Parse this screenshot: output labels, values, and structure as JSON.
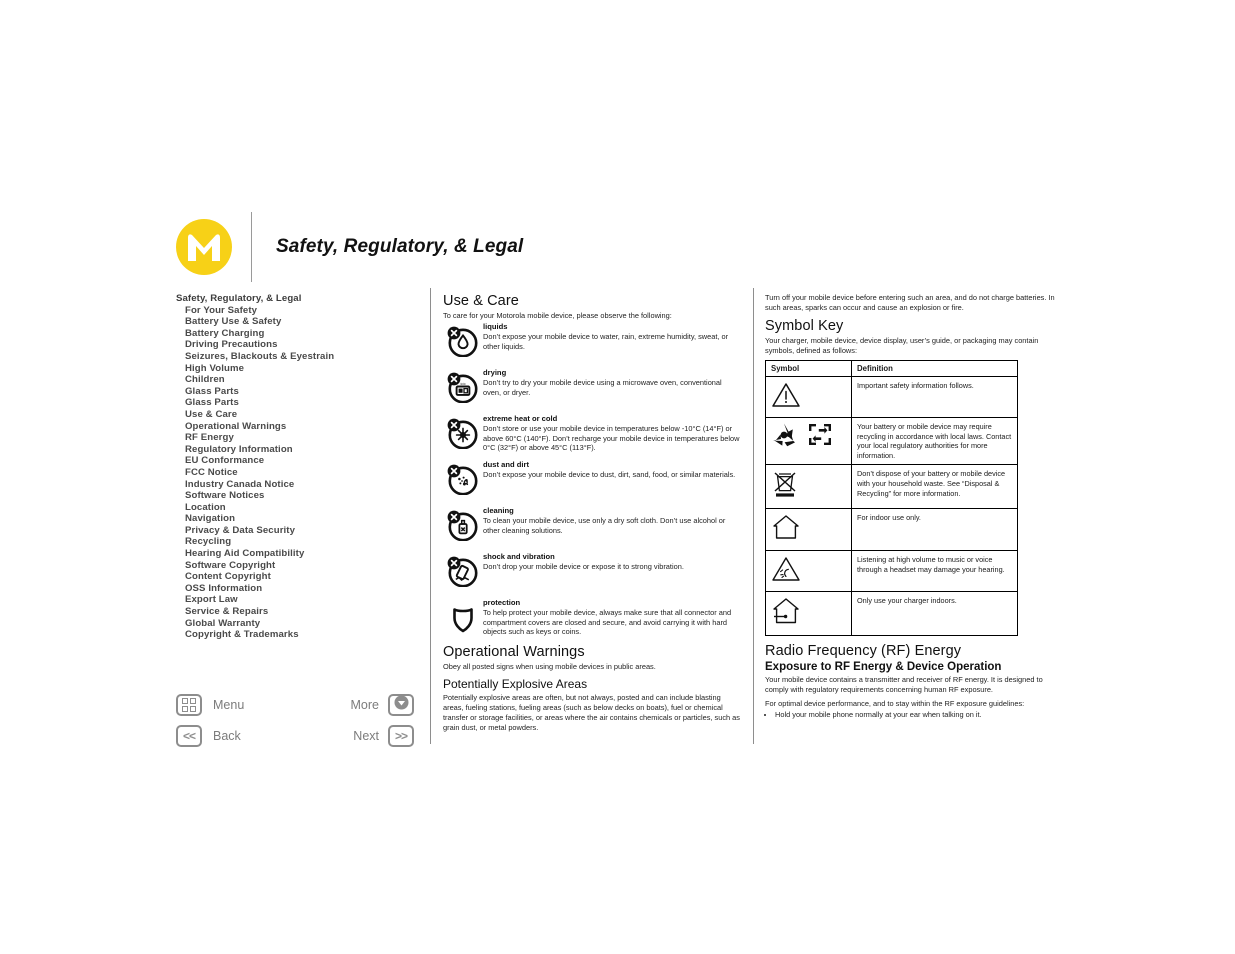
{
  "header": {
    "title": "Safety, Regulatory, & Legal",
    "logo_icon": "motorola-logo-icon"
  },
  "sidebar": {
    "title": "Safety, Regulatory, & Legal",
    "items": [
      "For Your Safety",
      "Battery Use & Safety",
      "Battery Charging",
      "Driving Precautions",
      "Seizures, Blackouts & Eyestrain",
      "High Volume",
      "Children",
      "Glass Parts",
      "Glass Parts",
      "Use & Care",
      "Operational Warnings",
      "RF Energy",
      "Regulatory Information",
      "EU Conformance",
      "FCC Notice",
      "Industry Canada Notice",
      "Software Notices",
      "Location",
      "Navigation",
      "Privacy & Data Security",
      "Recycling",
      "Hearing Aid Compatibility",
      "Software Copyright",
      "Content Copyright",
      "OSS Information",
      "Export Law",
      "Service & Repairs",
      "Global Warranty",
      "Copyright & Trademarks"
    ]
  },
  "nav_controls": {
    "menu_label": "Menu",
    "more_label": "More",
    "back_label": "Back",
    "next_label": "Next",
    "back_glyph": "<<",
    "next_glyph": ">>"
  },
  "use_care": {
    "heading": "Use & Care",
    "intro": "To care for your Motorola mobile device, please observe the following:",
    "items": [
      {
        "icon": "no-liquids-icon",
        "term": "liquids",
        "desc": "Don’t expose your mobile device to water, rain, extreme humidity, sweat, or other liquids."
      },
      {
        "icon": "no-drying-icon",
        "term": "drying",
        "desc": "Don’t try to dry your mobile device using a microwave oven, conventional oven, or dryer."
      },
      {
        "icon": "no-extreme-temperature-icon",
        "term": "extreme heat or cold",
        "desc": "Don’t store or use your mobile device in temperatures below -10°C (14°F) or above 60°C (140°F). Don’t recharge your mobile device in temperatures below 0°C (32°F) or above 45°C (113°F)."
      },
      {
        "icon": "no-dust-icon",
        "term": "dust and dirt",
        "desc": "Don’t expose your mobile device to dust, dirt, sand, food, or similar materials."
      },
      {
        "icon": "no-cleaning-solutions-icon",
        "term": "cleaning",
        "desc": "To clean your mobile device, use only a dry soft cloth. Don’t use alcohol or other cleaning solutions."
      },
      {
        "icon": "no-shock-vibration-icon",
        "term": "shock and vibration",
        "desc": "Don’t drop your mobile device or expose it to strong vibration."
      },
      {
        "icon": "shield-protection-icon",
        "term": "protection",
        "desc": "To help protect your mobile device, always make sure that all connector and compartment covers are closed and secure, and avoid carrying it with hard objects such as keys or coins."
      }
    ]
  },
  "operational_warnings": {
    "heading": "Operational Warnings",
    "intro": "Obey all posted signs when using mobile devices in public areas.",
    "subheading": "Potentially Explosive Areas",
    "body": "Potentially explosive areas are often, but not always, posted and can include blasting areas, fueling stations, fueling areas (such as below decks on boats), fuel or chemical transfer or storage facilities, or areas where the air contains chemicals or particles, such as grain dust, or metal powders."
  },
  "right_column": {
    "continuation": "Turn off your mobile device before entering such an area, and do not charge batteries. In such areas, sparks can occur and cause an explosion or fire.",
    "symbol_key": {
      "heading": "Symbol Key",
      "intro": "Your charger, mobile device, device display, user’s guide, or packaging may contain symbols, defined as follows:",
      "columns": [
        "Symbol",
        "Definition"
      ],
      "rows": [
        {
          "icons": [
            "warning-triangle-icon"
          ],
          "definition": "Important safety information follows."
        },
        {
          "icons": [
            "recycling-mobius-icon",
            "battery-recycling-icon"
          ],
          "definition": "Your battery or mobile device may require recycling in accordance with local laws. Contact your local regulatory authorities for more information."
        },
        {
          "icons": [
            "crossed-out-wheelie-bin-icon"
          ],
          "definition": "Don’t dispose of your battery or mobile device with your household waste. See “Disposal & Recycling” for more information."
        },
        {
          "icons": [
            "indoor-use-house-icon"
          ],
          "definition": "For indoor use only."
        },
        {
          "icons": [
            "hearing-warning-triangle-icon"
          ],
          "definition": "Listening at high volume to music or voice through a headset may damage your hearing."
        },
        {
          "icons": [
            "charger-indoors-house-icon"
          ],
          "definition": "Only use your charger indoors."
        }
      ]
    },
    "rf_energy": {
      "heading": "Radio Frequency (RF) Energy",
      "subheading": "Exposure to RF Energy & Device Operation",
      "para1": "Your mobile device contains a transmitter and receiver of RF energy. It is designed to comply with regulatory requirements concerning human RF exposure.",
      "para2": "For optimal device performance, and to stay within the RF exposure guidelines:",
      "bullets": [
        "Hold your mobile phone normally at your ear when talking on it."
      ]
    }
  },
  "colors": {
    "brand_yellow": "#F7D117",
    "nav_grey": "#8d8d8d",
    "text": "#1f1f1f"
  }
}
